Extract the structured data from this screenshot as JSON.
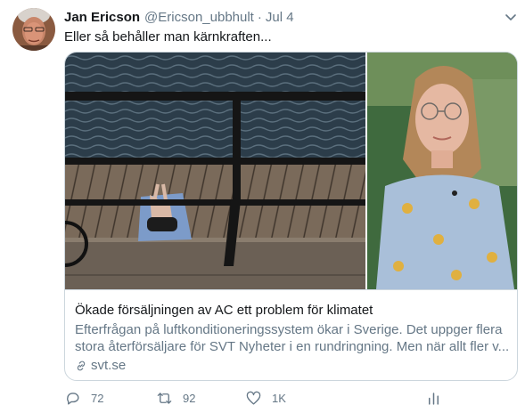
{
  "tweet": {
    "author_name": "Jan Ericson",
    "handle": "@Ericson_ubbhult",
    "separator": "·",
    "date": "Jul 4",
    "text": "Eller så behåller man kärnkraften..."
  },
  "card": {
    "title": "Ökade försäljningen av AC ett problem för klimatet",
    "description_line1": "Efterfrågan på luftkonditioneringssystem ökar i Sverige. Det uppger flera",
    "description_line2": "stora återförsäljare för SVT Nyheter i en rundringning. Men när allt fler v...",
    "domain": "svt.se"
  },
  "actions": {
    "reply_count": "72",
    "retweet_count": "92",
    "like_count": "1K"
  },
  "icons": {
    "caret": "chevron-down-icon",
    "link": "link-icon",
    "reply": "reply-icon",
    "retweet": "retweet-icon",
    "like": "heart-icon",
    "stats": "bar-chart-icon"
  },
  "colors": {
    "text": "#14171a",
    "secondary": "#657786",
    "border": "#ccd6dd"
  }
}
